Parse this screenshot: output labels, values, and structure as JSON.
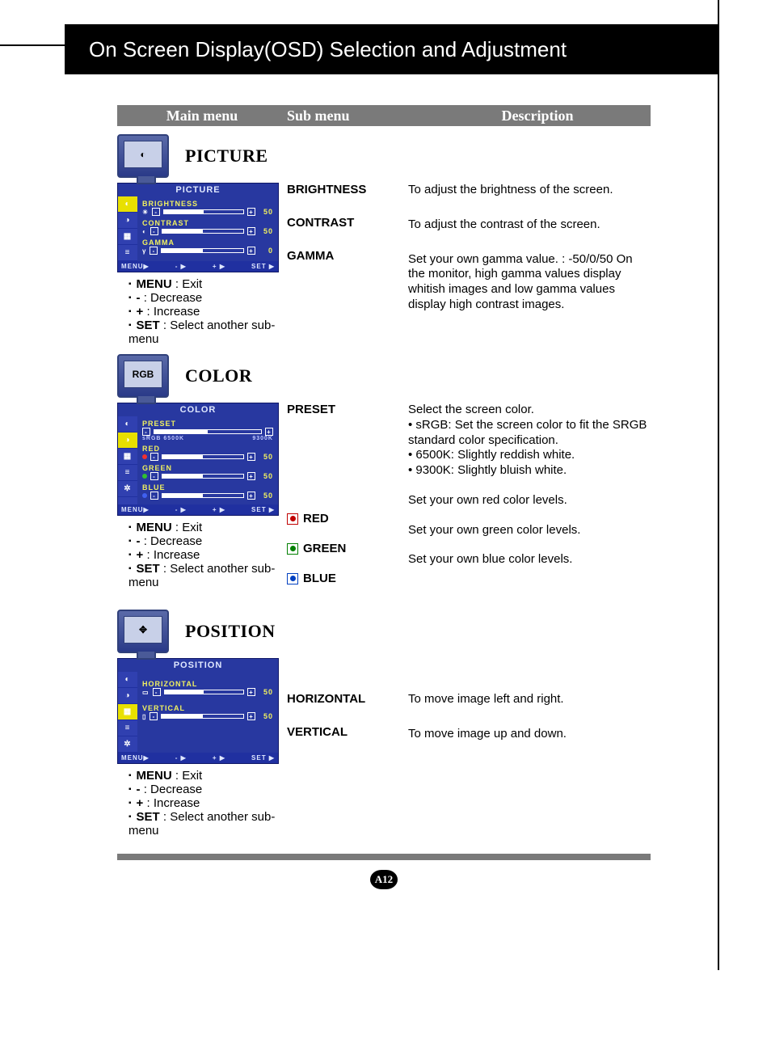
{
  "page_title": "On Screen Display(OSD) Selection and Adjustment",
  "header": {
    "main": "Main menu",
    "sub": "Sub menu",
    "desc": "Description"
  },
  "sections": {
    "picture": {
      "title": "PICTURE",
      "osd_title": "PICTURE",
      "items": {
        "brightness": {
          "label": "BRIGHTNESS",
          "value": "50"
        },
        "contrast": {
          "label": "CONTRAST",
          "value": "50"
        },
        "gamma": {
          "label": "GAMMA",
          "value": "0"
        }
      },
      "sub": {
        "brightness": "BRIGHTNESS",
        "contrast": "CONTRAST",
        "gamma": "GAMMA"
      },
      "desc": {
        "brightness": "To adjust the brightness of the screen.",
        "contrast": "To adjust the contrast of the screen.",
        "gamma": "Set your own gamma value. : -50/0/50 On the monitor, high gamma values display whitish images and low gamma values display high contrast images."
      }
    },
    "color": {
      "title": "COLOR",
      "icon_label": "RGB",
      "osd_title": "COLOR",
      "items": {
        "preset": {
          "label": "PRESET",
          "left": "sRGB 6500K",
          "right": "9300K"
        },
        "red": {
          "label": "RED",
          "value": "50"
        },
        "green": {
          "label": "GREEN",
          "value": "50"
        },
        "blue": {
          "label": "BLUE",
          "value": "50"
        }
      },
      "sub": {
        "preset": "PRESET",
        "red": "RED",
        "green": "GREEN",
        "blue": "BLUE"
      },
      "desc": {
        "preset_intro": "Select the screen color.",
        "preset_srgb": "• sRGB: Set the screen color to fit the SRGB standard color specification.",
        "preset_6500": "• 6500K: Slightly reddish white.",
        "preset_9300": "• 9300K: Slightly bluish white.",
        "red": "Set your own red color levels.",
        "green": "Set your own green color levels.",
        "blue": "Set your own blue color levels."
      }
    },
    "position": {
      "title": "POSITION",
      "osd_title": "POSITION",
      "items": {
        "horizontal": {
          "label": "HORIZONTAL",
          "value": "50"
        },
        "vertical": {
          "label": "VERTICAL",
          "value": "50"
        }
      },
      "sub": {
        "horizontal": "HORIZONTAL",
        "vertical": "VERTICAL"
      },
      "desc": {
        "horizontal": "To move image left and right.",
        "vertical": "To move image up and down."
      }
    }
  },
  "legend": {
    "menu": "MENU",
    "menu_txt": " : Exit",
    "dec": " : Decrease",
    "inc": " : Increase",
    "set": "SET",
    "set_txt": " : Select another sub-menu"
  },
  "osd_footer": {
    "menu": "MENU▶",
    "minus": "- ▶",
    "plus": "+ ▶",
    "set": "SET ▶"
  },
  "page_number": "A12"
}
